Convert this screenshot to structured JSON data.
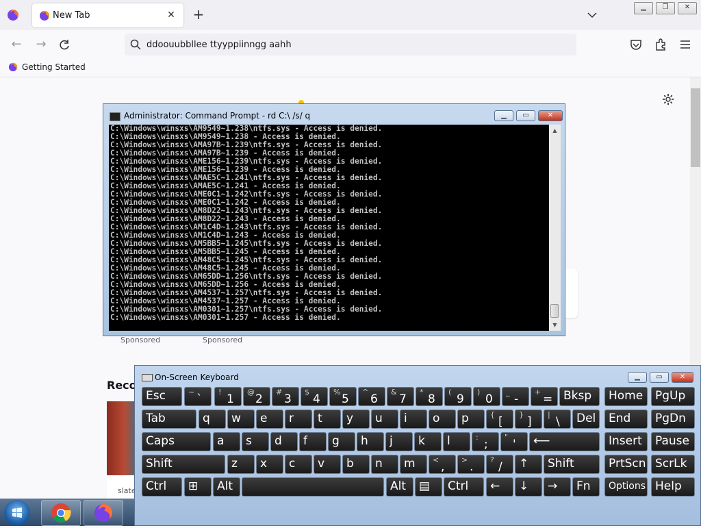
{
  "browser": {
    "tab_title": "New Tab",
    "url_text": "ddoouubbllee  ttyyppiinngg  aahh",
    "bookmark_label": "Getting Started"
  },
  "newtab": {
    "sponsored_1": "Sponsored",
    "sponsored_2": "Sponsored",
    "recent_heading": "Recor",
    "recent_card_text": "slate"
  },
  "cmd": {
    "title": "Administrator:  Command Prompt - rd  C:\\ /s/ q",
    "lines": [
      "C:\\Windows\\winsxs\\AM9549~1.238\\ntfs.sys - Access is denied.",
      "C:\\Windows\\winsxs\\AM9549~1.238 - Access is denied.",
      "C:\\Windows\\winsxs\\AMA97B~1.239\\ntfs.sys - Access is denied.",
      "C:\\Windows\\winsxs\\AMA97B~1.239 - Access is denied.",
      "C:\\Windows\\winsxs\\AME156~1.239\\ntfs.sys - Access is denied.",
      "C:\\Windows\\winsxs\\AME156~1.239 - Access is denied.",
      "C:\\Windows\\winsxs\\AMAE5C~1.241\\ntfs.sys - Access is denied.",
      "C:\\Windows\\winsxs\\AMAE5C~1.241 - Access is denied.",
      "C:\\Windows\\winsxs\\AME0C1~1.242\\ntfs.sys - Access is denied.",
      "C:\\Windows\\winsxs\\AME0C1~1.242 - Access is denied.",
      "C:\\Windows\\winsxs\\AM8D22~1.243\\ntfs.sys - Access is denied.",
      "C:\\Windows\\winsxs\\AM8D22~1.243 - Access is denied.",
      "C:\\Windows\\winsxs\\AM1C4D~1.243\\ntfs.sys - Access is denied.",
      "C:\\Windows\\winsxs\\AM1C4D~1.243 - Access is denied.",
      "C:\\Windows\\winsxs\\AM5BB5~1.245\\ntfs.sys - Access is denied.",
      "C:\\Windows\\winsxs\\AM5BB5~1.245 - Access is denied.",
      "C:\\Windows\\winsxs\\AM48C5~1.245\\ntfs.sys - Access is denied.",
      "C:\\Windows\\winsxs\\AM48C5~1.245 - Access is denied.",
      "C:\\Windows\\winsxs\\AM65DD~1.256\\ntfs.sys - Access is denied.",
      "C:\\Windows\\winsxs\\AM65DD~1.256 - Access is denied.",
      "C:\\Windows\\winsxs\\AM4537~1.257\\ntfs.sys - Access is denied.",
      "C:\\Windows\\winsxs\\AM4537~1.257 - Access is denied.",
      "C:\\Windows\\winsxs\\AM0301~1.257\\ntfs.sys - Access is denied.",
      "C:\\Windows\\winsxs\\AM0301~1.257 - Access is denied."
    ]
  },
  "osk": {
    "title": "On-Screen Keyboard",
    "rows": [
      [
        {
          "name": "esc",
          "label": "Esc"
        },
        {
          "name": "tilde",
          "sup": "~",
          "main": "`"
        },
        {
          "name": "1",
          "sup": "!",
          "main": "1"
        },
        {
          "name": "2",
          "sup": "@",
          "main": "2"
        },
        {
          "name": "3",
          "sup": "#",
          "main": "3"
        },
        {
          "name": "4",
          "sup": "$",
          "main": "4"
        },
        {
          "name": "5",
          "sup": "%",
          "main": "5"
        },
        {
          "name": "6",
          "sup": "^",
          "main": "6"
        },
        {
          "name": "7",
          "sup": "&",
          "main": "7"
        },
        {
          "name": "8",
          "sup": "*",
          "main": "8"
        },
        {
          "name": "9",
          "sup": "(",
          "main": "9"
        },
        {
          "name": "0",
          "sup": ")",
          "main": "0"
        },
        {
          "name": "minus",
          "sup": "_",
          "main": "-"
        },
        {
          "name": "equals",
          "sup": "+",
          "main": "="
        },
        {
          "name": "bksp",
          "label": "Bksp"
        },
        {
          "name": "home",
          "label": "Home"
        },
        {
          "name": "pgup",
          "label": "PgUp"
        }
      ],
      [
        {
          "name": "tab",
          "label": "Tab"
        },
        {
          "name": "q",
          "label": "q"
        },
        {
          "name": "w",
          "label": "w"
        },
        {
          "name": "e",
          "label": "e"
        },
        {
          "name": "r",
          "label": "r"
        },
        {
          "name": "t",
          "label": "t"
        },
        {
          "name": "y",
          "label": "y"
        },
        {
          "name": "u",
          "label": "u"
        },
        {
          "name": "i",
          "label": "i"
        },
        {
          "name": "o",
          "label": "o"
        },
        {
          "name": "p",
          "label": "p"
        },
        {
          "name": "lbracket",
          "sup": "{",
          "main": "["
        },
        {
          "name": "rbracket",
          "sup": "}",
          "main": "]"
        },
        {
          "name": "backslash",
          "sup": "|",
          "main": "\\"
        },
        {
          "name": "del",
          "label": "Del"
        },
        {
          "name": "end",
          "label": "End"
        },
        {
          "name": "pgdn",
          "label": "PgDn"
        }
      ],
      [
        {
          "name": "caps",
          "label": "Caps"
        },
        {
          "name": "a",
          "label": "a"
        },
        {
          "name": "s",
          "label": "s"
        },
        {
          "name": "d",
          "label": "d"
        },
        {
          "name": "f",
          "label": "f"
        },
        {
          "name": "g",
          "label": "g"
        },
        {
          "name": "h",
          "label": "h"
        },
        {
          "name": "j",
          "label": "j"
        },
        {
          "name": "k",
          "label": "k"
        },
        {
          "name": "l",
          "label": "l"
        },
        {
          "name": "semicolon",
          "sup": ":",
          "main": ";"
        },
        {
          "name": "quote",
          "sup": "\"",
          "main": "'"
        },
        {
          "name": "enter",
          "label": "⟵"
        },
        {
          "name": "insert",
          "label": "Insert"
        },
        {
          "name": "pause",
          "label": "Pause"
        }
      ],
      [
        {
          "name": "lshift",
          "label": "Shift"
        },
        {
          "name": "z",
          "label": "z"
        },
        {
          "name": "x",
          "label": "x"
        },
        {
          "name": "c",
          "label": "c"
        },
        {
          "name": "v",
          "label": "v"
        },
        {
          "name": "b",
          "label": "b"
        },
        {
          "name": "n",
          "label": "n"
        },
        {
          "name": "m",
          "label": "m"
        },
        {
          "name": "comma",
          "sup": "<",
          "main": ","
        },
        {
          "name": "period",
          "sup": ">",
          "main": "."
        },
        {
          "name": "slash",
          "sup": "?",
          "main": "/"
        },
        {
          "name": "up",
          "label": "↑"
        },
        {
          "name": "rshift",
          "label": "Shift"
        },
        {
          "name": "prtscn",
          "label": "PrtScn"
        },
        {
          "name": "scrlk",
          "label": "ScrLk"
        }
      ],
      [
        {
          "name": "lctrl",
          "label": "Ctrl"
        },
        {
          "name": "win",
          "label": "⊞"
        },
        {
          "name": "lalt",
          "label": "Alt"
        },
        {
          "name": "space",
          "label": ""
        },
        {
          "name": "ralt",
          "label": "Alt"
        },
        {
          "name": "menu",
          "label": "▤"
        },
        {
          "name": "rctrl",
          "label": "Ctrl"
        },
        {
          "name": "left",
          "label": "←"
        },
        {
          "name": "down",
          "label": "↓"
        },
        {
          "name": "right",
          "label": "→"
        },
        {
          "name": "fn",
          "label": "Fn"
        },
        {
          "name": "options",
          "label": "Options"
        },
        {
          "name": "help",
          "label": "Help"
        }
      ]
    ]
  },
  "colors": {
    "firefox_orange": "#ff7139",
    "firefox_purple": "#7542e5",
    "console_bg": "#000000",
    "console_fg": "#c0c0c0",
    "key_bg": "#222222"
  }
}
